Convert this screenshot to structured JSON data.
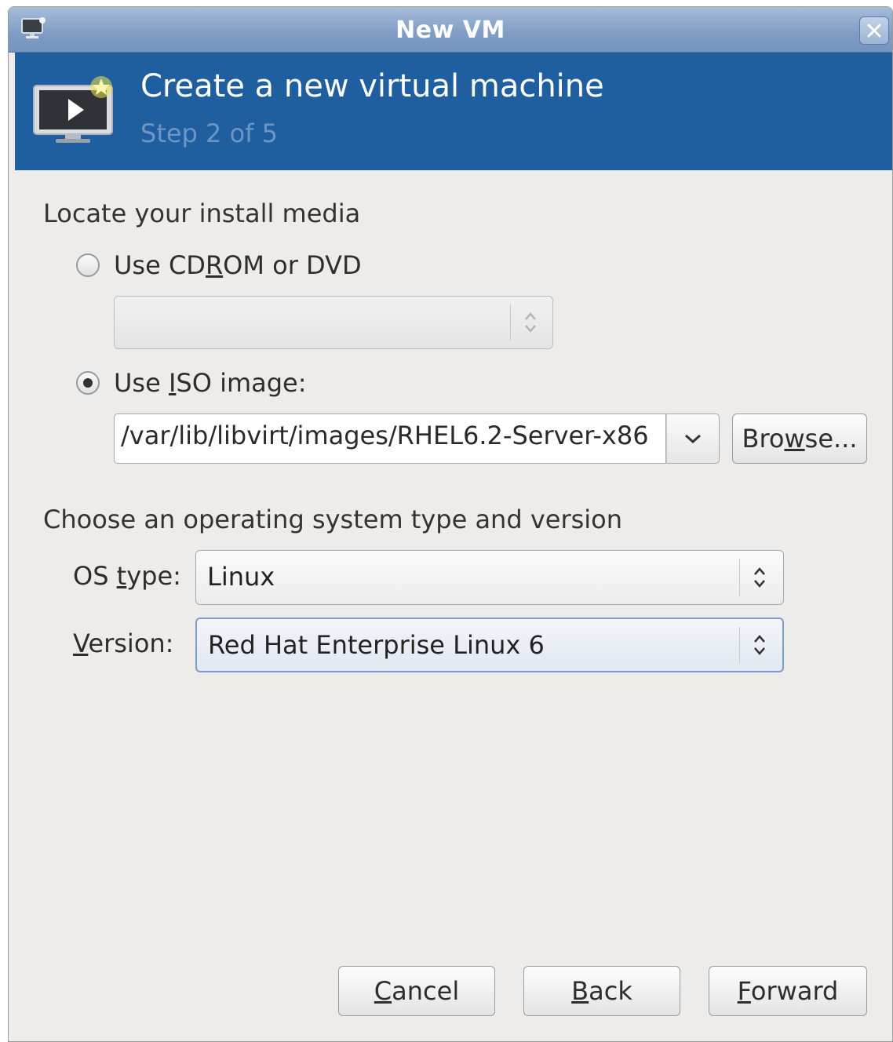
{
  "window": {
    "title": "New VM",
    "title_bar_color": "#7f9cc4",
    "app_icon": "monitor-icon",
    "close_icon": "close-icon"
  },
  "header": {
    "title": "Create a new virtual machine",
    "step": "Step 2 of 5",
    "banner_color": "#1f5fa0",
    "icon": "vm-monitor-play-icon"
  },
  "media": {
    "section_label": "Locate your install media",
    "cdrom": {
      "pre": "Use CD",
      "mnemonic": "R",
      "post": "OM or DVD",
      "selected": false
    },
    "cdrom_combo_value": "",
    "iso": {
      "pre": "Use ",
      "mnemonic": "I",
      "post": "SO image:",
      "selected": true
    },
    "iso_path": "/var/lib/libvirt/images/RHEL6.2-Server-x86",
    "browse": {
      "pre": "Bro",
      "mnemonic": "w",
      "post": "se..."
    }
  },
  "os": {
    "section_label": "Choose an operating system type and version",
    "os_type_label": {
      "pre": "OS ",
      "mnemonic": "t",
      "post": "ype:"
    },
    "os_type_value": "Linux",
    "version_label": {
      "pre": "",
      "mnemonic": "V",
      "post": "ersion:"
    },
    "version_value": "Red Hat Enterprise Linux 6"
  },
  "buttons": {
    "cancel": {
      "pre": "",
      "mnemonic": "C",
      "post": "ancel"
    },
    "back": {
      "pre": "",
      "mnemonic": "B",
      "post": "ack"
    },
    "forward": {
      "pre": "",
      "mnemonic": "F",
      "post": "orward"
    }
  }
}
